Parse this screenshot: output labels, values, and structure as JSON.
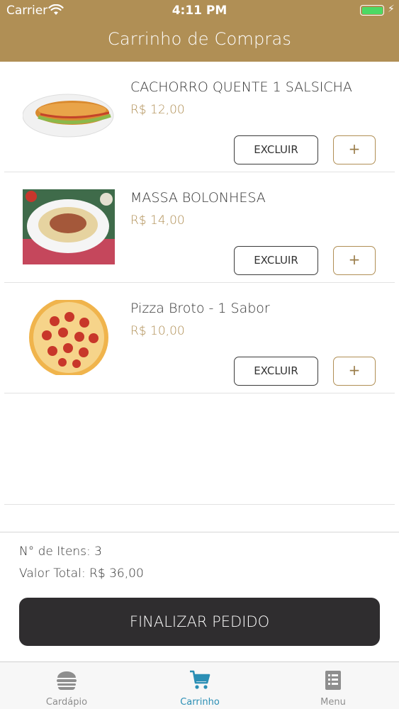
{
  "status_bar": {
    "carrier": "Carrier",
    "time": "4:11 PM"
  },
  "header": {
    "title": "Carrinho de Compras"
  },
  "cart": {
    "items": [
      {
        "name": "CACHORRO QUENTE 1 SALSICHA",
        "price": "R$ 12,00",
        "image": "hot-dog",
        "delete_label": "EXCLUIR",
        "add_label": "+"
      },
      {
        "name": "MASSA BOLONHESA",
        "price": "R$ 14,00",
        "image": "pasta",
        "delete_label": "EXCLUIR",
        "add_label": "+"
      },
      {
        "name": "Pizza Broto - 1 Sabor",
        "price": "R$ 10,00",
        "image": "pizza",
        "delete_label": "EXCLUIR",
        "add_label": "+"
      }
    ]
  },
  "summary": {
    "count_text": "N° de Itens: 3",
    "total_text": "Valor Total:  R$ 36,00"
  },
  "checkout": {
    "label": "FINALIZAR PEDIDO"
  },
  "tabbar": {
    "tabs": [
      {
        "label": "Cardápio",
        "icon": "burger-icon",
        "active": false
      },
      {
        "label": "Carrinho",
        "icon": "cart-icon",
        "active": true
      },
      {
        "label": "Menu",
        "icon": "list-icon",
        "active": false
      }
    ]
  },
  "colors": {
    "accent": "#b08f55",
    "dark_button": "#2f2d2f",
    "active_tab": "#2b8fb5"
  }
}
